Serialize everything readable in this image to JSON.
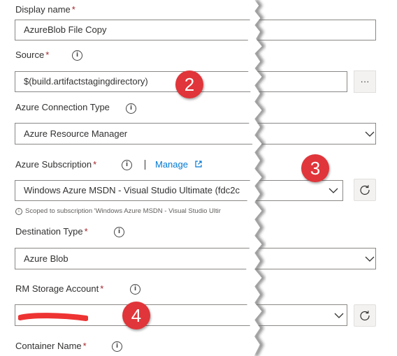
{
  "display_name": {
    "label": "Display name",
    "required_mark": "*",
    "value": "AzureBlob File Copy"
  },
  "source": {
    "label": "Source",
    "required_mark": "*",
    "value": "$(build.artifactstagingdirectory)",
    "browse_label": "···"
  },
  "azure_connection_type": {
    "label": "Azure Connection Type",
    "value": "Azure Resource Manager"
  },
  "azure_subscription": {
    "label": "Azure Subscription",
    "required_mark": "*",
    "manage_link": "Manage",
    "value": "Windows Azure MSDN - Visual Studio Ultimate (fdc2c",
    "scope_note": "Scoped to subscription 'Windows Azure MSDN - Visual Studio Ultir"
  },
  "destination_type": {
    "label": "Destination Type",
    "required_mark": "*",
    "value": "Azure Blob"
  },
  "rm_storage_account": {
    "label": "RM Storage Account",
    "required_mark": "*",
    "value": ""
  },
  "container_name": {
    "label": "Container Name",
    "required_mark": "*"
  },
  "annotations": {
    "badge_2": "2",
    "badge_3": "3",
    "badge_4": "4"
  },
  "colors": {
    "badge": "#e0353a",
    "link": "#0078d4",
    "required": "#a4262c",
    "redaction": "#ee3333"
  }
}
